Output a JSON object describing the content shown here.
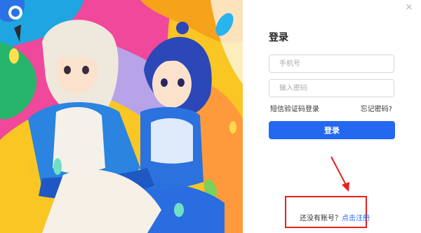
{
  "login": {
    "title": "登录",
    "phone_placeholder": "手机号",
    "password_placeholder": "输入密码",
    "sms_login": "短信验证码登录",
    "forgot_password": "忘记密码?",
    "login_button": "登录"
  },
  "register": {
    "prompt": "还没有账号？",
    "link": "点击注册"
  },
  "window": {
    "close_glyph": "×"
  },
  "colors": {
    "primary": "#2468f2",
    "annotation": "#e82020"
  }
}
